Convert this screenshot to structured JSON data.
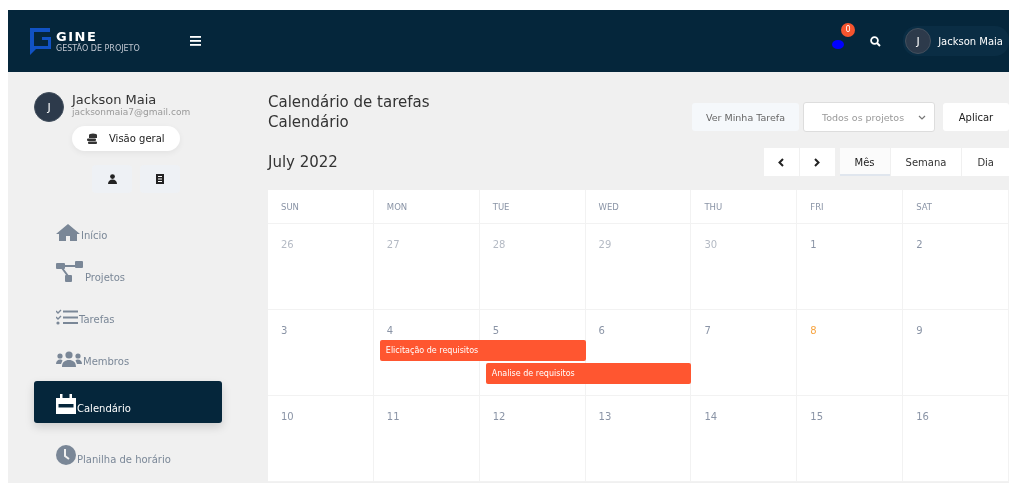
{
  "header": {
    "logo_text": "GINE",
    "logo_subtitle": "GESTÃO DE PROJETO",
    "notification_count": "0",
    "user_initial": "J",
    "user_name": "Jackson Maia"
  },
  "profile": {
    "initial": "J",
    "name": "Jackson Maia",
    "email": "jacksonmaia7@gmail.com",
    "overview_button": "Visão geral"
  },
  "nav": [
    {
      "kind": "home",
      "label": "Início",
      "selected": false
    },
    {
      "kind": "projects",
      "label": "Projetos",
      "selected": false
    },
    {
      "kind": "tasks",
      "label": "Tarefas",
      "selected": false
    },
    {
      "kind": "members",
      "label": "Membros",
      "selected": false
    },
    {
      "kind": "calendar",
      "label": "Calendário",
      "selected": true
    },
    {
      "kind": "clock",
      "label": "Planilha de horário",
      "selected": false
    }
  ],
  "page": {
    "title": "Calendário de tarefas",
    "subtitle": "Calendário",
    "month": "July 2022",
    "my_tasks_button": "Ver Minha Tarefa",
    "project_select": "Todos os projetos",
    "apply_button": "Aplicar"
  },
  "views": [
    {
      "label": "Mês",
      "selected": true
    },
    {
      "label": "Semana",
      "selected": false
    },
    {
      "label": "Dia",
      "selected": false
    }
  ],
  "weekdays": [
    "SUN",
    "MON",
    "TUE",
    "WED",
    "THU",
    "FRI",
    "SAT"
  ],
  "weeks": [
    {
      "days": [
        {
          "label": "26",
          "muted": true,
          "today": false
        },
        {
          "label": "27",
          "muted": true,
          "today": false
        },
        {
          "label": "28",
          "muted": true,
          "today": false
        },
        {
          "label": "29",
          "muted": true,
          "today": false
        },
        {
          "label": "30",
          "muted": true,
          "today": false
        },
        {
          "label": "1",
          "muted": false,
          "today": false
        },
        {
          "label": "2",
          "muted": false,
          "today": false
        }
      ]
    },
    {
      "days": [
        {
          "label": "3",
          "muted": false,
          "today": false
        },
        {
          "label": "4",
          "muted": false,
          "today": false,
          "events": [
            "Elicitação de requisitos"
          ]
        },
        {
          "label": "5",
          "muted": false,
          "today": false,
          "events": [
            "Analise de requisitos"
          ]
        },
        {
          "label": "6",
          "muted": false,
          "today": false
        },
        {
          "label": "7",
          "muted": false,
          "today": false
        },
        {
          "label": "8",
          "muted": false,
          "today": true
        },
        {
          "label": "9",
          "muted": false,
          "today": false
        }
      ]
    },
    {
      "days": [
        {
          "label": "10",
          "muted": false,
          "today": false
        },
        {
          "label": "11",
          "muted": false,
          "today": false
        },
        {
          "label": "12",
          "muted": false,
          "today": false
        },
        {
          "label": "13",
          "muted": false,
          "today": false
        },
        {
          "label": "14",
          "muted": false,
          "today": false
        },
        {
          "label": "15",
          "muted": false,
          "today": false
        },
        {
          "label": "16",
          "muted": false,
          "today": false
        }
      ]
    }
  ]
}
